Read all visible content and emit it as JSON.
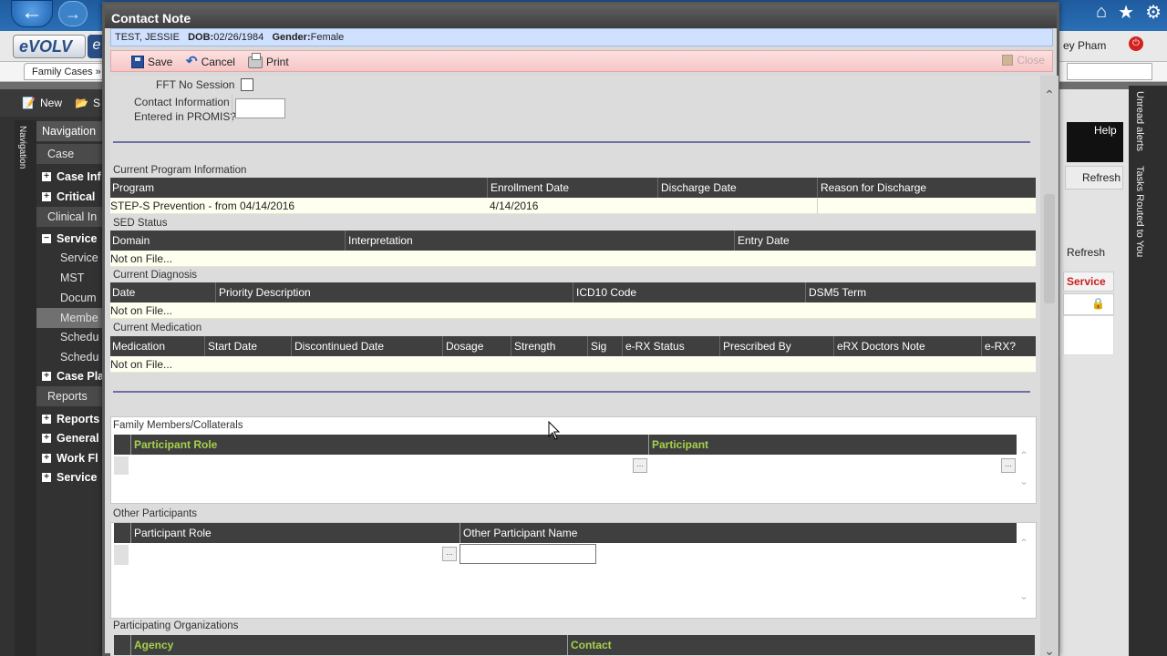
{
  "app": {
    "logo": "eVOLV",
    "user_name": "ey Pham",
    "breadcrumb": "Family Cases »",
    "toolbar_new": "New",
    "toolbar_s": "S",
    "nav_strip_label": "Navigation",
    "nav": {
      "navigation": "Navigation",
      "case": "Case",
      "case_info": "Case Inf",
      "critical": "Critical",
      "clinical": "Clinical In",
      "service": "Service",
      "service_item": "Service",
      "mst": "MST",
      "documents": "Docum",
      "members": "Membe",
      "schedule1": "Schedu",
      "schedule2": "Schedu",
      "case_plan": "Case Pla",
      "reports": "Reports",
      "reports2": "Reports",
      "general": "General",
      "work_flow": "Work Fl",
      "service2": "Service"
    },
    "right": {
      "help": "Help",
      "refresh1": "Refresh",
      "refresh2": "Refresh",
      "service": "Service",
      "unread_alerts": "Unread alerts",
      "tasks_routed": "Tasks Routed to You"
    }
  },
  "modal": {
    "title": "Contact Note",
    "patient": {
      "name": "TEST, JESSIE",
      "dob_label": "DOB:",
      "dob": "02/26/1984",
      "gender_label": "Gender:",
      "gender": "Female"
    },
    "commands": {
      "save": "Save",
      "cancel": "Cancel",
      "print": "Print",
      "close": "Close"
    },
    "fft_label": "FFT No Session",
    "contact_info_label_1": "Contact Information",
    "contact_info_label_2": "Entered in PROMIS?",
    "program": {
      "title": "Current Program Information",
      "headers": [
        "Program",
        "Enrollment Date",
        "Discharge Date",
        "Reason for Discharge"
      ],
      "row": [
        "STEP-S Prevention - from 04/14/2016",
        "4/14/2016",
        "",
        ""
      ]
    },
    "sed": {
      "title": "SED Status",
      "headers": [
        "Domain",
        "Interpretation",
        "Entry Date"
      ],
      "empty": "Not on File..."
    },
    "diagnosis": {
      "title": "Current Diagnosis",
      "headers": [
        "Date",
        "Priority Description",
        "ICD10 Code",
        "DSM5 Term"
      ],
      "empty": "Not on File..."
    },
    "medication": {
      "title": "Current Medication",
      "headers": [
        "Medication",
        "Start Date",
        "Discontinued Date",
        "Dosage",
        "Strength",
        "Sig",
        "e-RX Status",
        "Prescribed By",
        "eRX Doctors Note",
        "e-RX?"
      ],
      "empty": "Not on File..."
    },
    "family": {
      "title": "Family Members/Collaterals",
      "headers": [
        "Participant Role",
        "Participant"
      ]
    },
    "other": {
      "title": "Other Participants",
      "headers": [
        "Participant Role",
        "Other Participant Name"
      ]
    },
    "orgs": {
      "title": "Participating Organizations",
      "headers": [
        "Agency",
        "Contact"
      ]
    },
    "ellipsis": "..."
  }
}
